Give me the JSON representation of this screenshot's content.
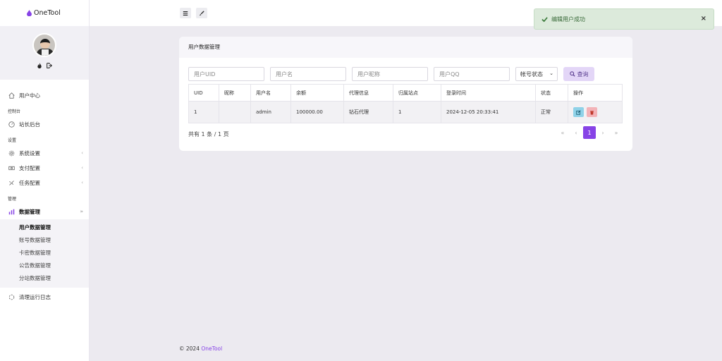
{
  "brand": {
    "name": "OneTool"
  },
  "sidebar": {
    "user_center": "用户中心",
    "sections": {
      "console": "控制台",
      "settings": "设置",
      "manage": "管理"
    },
    "console_items": [
      "站长后台"
    ],
    "settings_items": [
      "系统设置",
      "支付配置",
      "任务配置"
    ],
    "manage_item": "数据管理",
    "sub_items": [
      "用户数据管理",
      "账号数据管理",
      "卡密数据管理",
      "公告数据管理",
      "分站数据管理"
    ],
    "log_item": "清理运行日志"
  },
  "toast": {
    "message": "编辑用户成功",
    "close": "×"
  },
  "card": {
    "title": "用户数据管理",
    "filters": {
      "uid_placeholder": "用户UID",
      "username_placeholder": "用户名",
      "nickname_placeholder": "用户昵称",
      "qq_placeholder": "用户QQ",
      "status_select": "帐号状态",
      "search_button": "查询"
    },
    "table": {
      "headers": [
        "UID",
        "昵称",
        "用户名",
        "余额",
        "代理信息",
        "归属站点",
        "登录时间",
        "状态",
        "操作"
      ],
      "rows": [
        [
          "1",
          "",
          "admin",
          "100000.00",
          "钻石代理",
          "1",
          "2024-12-05 20:33:41",
          "正常"
        ]
      ]
    },
    "summary": "共有 1 条 / 1 页",
    "pager": {
      "first": "«",
      "prev": "‹",
      "current": "1",
      "next": "›",
      "last": "»"
    }
  },
  "footer": {
    "copyright": "© 2024",
    "brand": "OneTool"
  },
  "colors": {
    "accent": "#8743e6",
    "toast_bg": "#dceadb",
    "edit_btn": "#8fd2e8",
    "delete_btn": "#f3b3b8"
  }
}
